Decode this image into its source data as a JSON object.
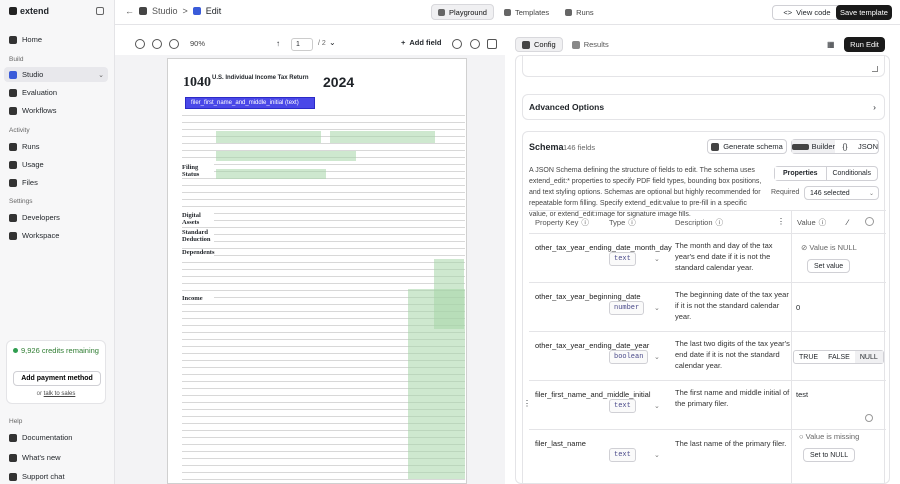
{
  "sidebar": {
    "logo": "extend",
    "items_top": [
      {
        "label": "Home"
      }
    ],
    "build_label": "Build",
    "build_items": [
      {
        "label": "Studio"
      },
      {
        "label": "Evaluation"
      },
      {
        "label": "Workflows"
      }
    ],
    "activity_label": "Activity",
    "activity_items": [
      {
        "label": "Runs"
      },
      {
        "label": "Usage"
      },
      {
        "label": "Files"
      }
    ],
    "settings_label": "Settings",
    "settings_items": [
      {
        "label": "Developers"
      },
      {
        "label": "Workspace"
      }
    ],
    "help_label": "Help",
    "help_items": [
      {
        "label": "Documentation"
      },
      {
        "label": "What's new"
      },
      {
        "label": "Support chat"
      }
    ],
    "credits": {
      "text": "9,926 credits remaining",
      "button": "Add payment method",
      "or": "or",
      "link": "talk to sales"
    }
  },
  "topbar": {
    "crumb_parent": "Studio",
    "crumb_sep": ">",
    "crumb_current": "Edit",
    "tabs": [
      {
        "label": "Playground"
      },
      {
        "label": "Templates"
      },
      {
        "label": "Runs"
      }
    ],
    "view_code": "View code",
    "save_template": "Save template"
  },
  "pdf": {
    "zoom": "90%",
    "page": "1",
    "page_total": "/ 2",
    "add_field": "Add field",
    "form_number": "1040",
    "form_title": "U.S. Individual Income Tax Return",
    "year": "2024",
    "selected_field": "filer_first_name_and_middle_initial (text)",
    "left_labels": [
      "Filing Status",
      "Digital Assets",
      "Standard Deduction",
      "Dependents",
      "Income"
    ]
  },
  "right": {
    "tabs": [
      {
        "label": "Config"
      },
      {
        "label": "Results"
      }
    ],
    "run_edit": "Run Edit",
    "advanced_options": "Advanced Options",
    "schema": {
      "title": "Schema",
      "count": "146 fields",
      "generate": "Generate schema",
      "builder": "Builder",
      "json": "JSON",
      "description": "A JSON Schema defining the structure of fields to edit. The schema uses extend_edit:* properties to specify PDF field types, bounding box positions, and text styling options. Schemas are optional but highly recommended for repeatable form filling. Specify extend_edit:value to pre-fill in a specific value, or extend_edit:image for signature image fills.",
      "properties_tab": "Properties",
      "conditionals_tab": "Conditionals",
      "required_label": "Required",
      "required_value": "146 selected",
      "columns": {
        "key": "Property Key",
        "type": "Type",
        "description": "Description",
        "value": "Value"
      },
      "rows": [
        {
          "key": "other_tax_year_ending_date_month_day",
          "type": "text",
          "description": "The month and day of the tax year's end date if it is not the standard calendar year.",
          "value_status": "Value is NULL",
          "value_button": "Set value"
        },
        {
          "key": "other_tax_year_beginning_date",
          "type": "number",
          "description": "The beginning date of the tax year if it is not the standard calendar year.",
          "value": "0"
        },
        {
          "key": "other_tax_year_ending_date_year",
          "type": "boolean",
          "description": "The last two digits of the tax year's end date if it is not the standard calendar year.",
          "bool_options": [
            "TRUE",
            "FALSE",
            "NULL"
          ]
        },
        {
          "key": "filer_first_name_and_middle_initial",
          "type": "text",
          "description": "The first name and middle initial of the primary filer.",
          "value": "test"
        },
        {
          "key": "filer_last_name",
          "type": "text",
          "description": "The last name of the primary filer.",
          "value_status": "Value is missing",
          "value_button": "Set to NULL"
        }
      ]
    }
  }
}
